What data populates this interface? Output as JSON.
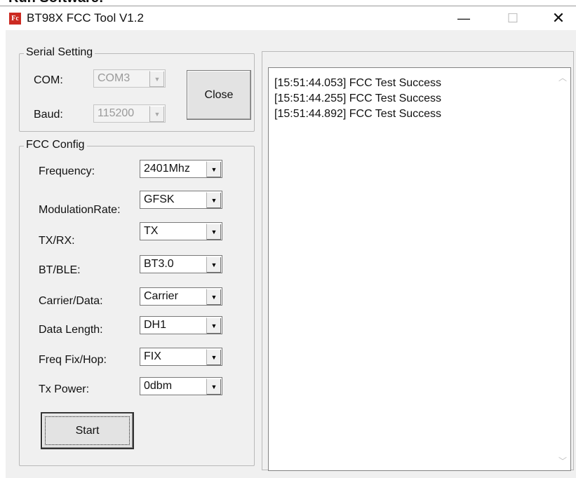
{
  "top_caption": "Run Software:",
  "window": {
    "title": "BT98X FCC Tool V1.2",
    "icon": "app-logo-icon",
    "controls": {
      "minimize": "—",
      "maximize": "☐",
      "close": "✕"
    }
  },
  "serial": {
    "legend": "Serial Setting",
    "com_label": "COM:",
    "com_value": "COM3",
    "baud_label": "Baud:",
    "baud_value": "115200",
    "close_label": "Close"
  },
  "fcc": {
    "legend": "FCC Config",
    "rows": [
      {
        "label": "Frequency:",
        "value": "2401Mhz"
      },
      {
        "label": "ModulationRate:",
        "value": "GFSK"
      },
      {
        "label": "TX/RX:",
        "value": "TX"
      },
      {
        "label": "BT/BLE:",
        "value": "BT3.0"
      },
      {
        "label": "Carrier/Data:",
        "value": "Carrier"
      },
      {
        "label": "Data Length:",
        "value": "DH1"
      },
      {
        "label": "Freq Fix/Hop:",
        "value": "FIX"
      },
      {
        "label": "Tx Power:",
        "value": "0dbm"
      }
    ],
    "start_label": "Start"
  },
  "log": {
    "lines": [
      "[15:51:44.053] FCC Test Success",
      "[15:51:44.255] FCC Test Success",
      "[15:51:44.892] FCC Test Success"
    ]
  }
}
